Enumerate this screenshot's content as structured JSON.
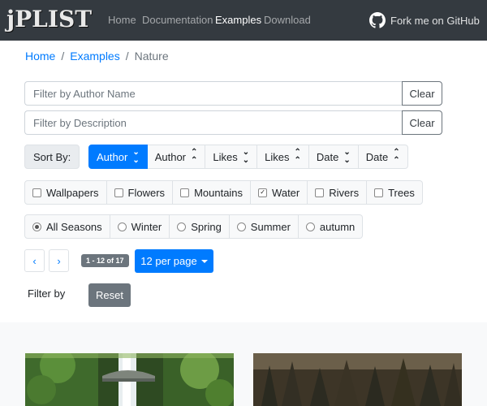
{
  "navbar": {
    "brand": "jPLIST",
    "links": [
      {
        "label": "Home",
        "active": false
      },
      {
        "label": "Documentation",
        "active": false
      },
      {
        "label": "Examples",
        "active": true
      },
      {
        "label": "Download",
        "active": false
      }
    ],
    "github_label": "Fork me on GitHub"
  },
  "breadcrumb": {
    "items": [
      "Home",
      "Examples"
    ],
    "separator": "/",
    "current": "Nature"
  },
  "filters": {
    "author_placeholder": "Filter by Author Name",
    "author_clear": "Clear",
    "description_placeholder": "Filter by Description",
    "description_clear": "Clear"
  },
  "sort": {
    "label": "Sort By:",
    "options": [
      {
        "label": "Author",
        "direction": "desc",
        "active": true
      },
      {
        "label": "Author",
        "direction": "asc",
        "active": false
      },
      {
        "label": "Likes",
        "direction": "desc",
        "active": false
      },
      {
        "label": "Likes",
        "direction": "asc",
        "active": false
      },
      {
        "label": "Date",
        "direction": "desc",
        "active": false
      },
      {
        "label": "Date",
        "direction": "asc",
        "active": false
      }
    ]
  },
  "categories": [
    {
      "label": "Wallpapers",
      "checked": false
    },
    {
      "label": "Flowers",
      "checked": false
    },
    {
      "label": "Mountains",
      "checked": false
    },
    {
      "label": "Water",
      "checked": true
    },
    {
      "label": "Rivers",
      "checked": false
    },
    {
      "label": "Trees",
      "checked": false
    }
  ],
  "seasons": [
    {
      "label": "All Seasons",
      "selected": true
    },
    {
      "label": "Winter",
      "selected": false
    },
    {
      "label": "Spring",
      "selected": false
    },
    {
      "label": "Summer",
      "selected": false
    },
    {
      "label": "autumn",
      "selected": false
    }
  ],
  "pagination": {
    "prev": "‹",
    "next": "›",
    "range_badge": "1 - 12 of 17",
    "per_page": "12 per page"
  },
  "filter_by": {
    "label": "Filter by",
    "reset": "Reset"
  },
  "colors": {
    "navbar": "#343a40",
    "primary": "#007bff",
    "secondary": "#6c757d"
  }
}
